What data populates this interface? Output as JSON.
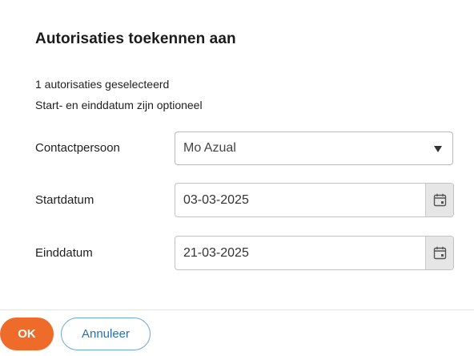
{
  "dialog": {
    "title": "Autorisaties toekennen aan",
    "info_line1": "1 autorisaties geselecteerd",
    "info_line2": "Start- en einddatum zijn optioneel"
  },
  "form": {
    "contact_label": "Contactpersoon",
    "contact_value": "Mo Azual",
    "start_label": "Startdatum",
    "start_value": "03-03-2025",
    "end_label": "Einddatum",
    "end_value": "21-03-2025"
  },
  "footer": {
    "ok_label": "OK",
    "cancel_label": "Annuleer"
  },
  "colors": {
    "ok_button": "#ef6b29",
    "cancel_border": "#6aa9d8",
    "cancel_text": "#2a6fb0"
  }
}
